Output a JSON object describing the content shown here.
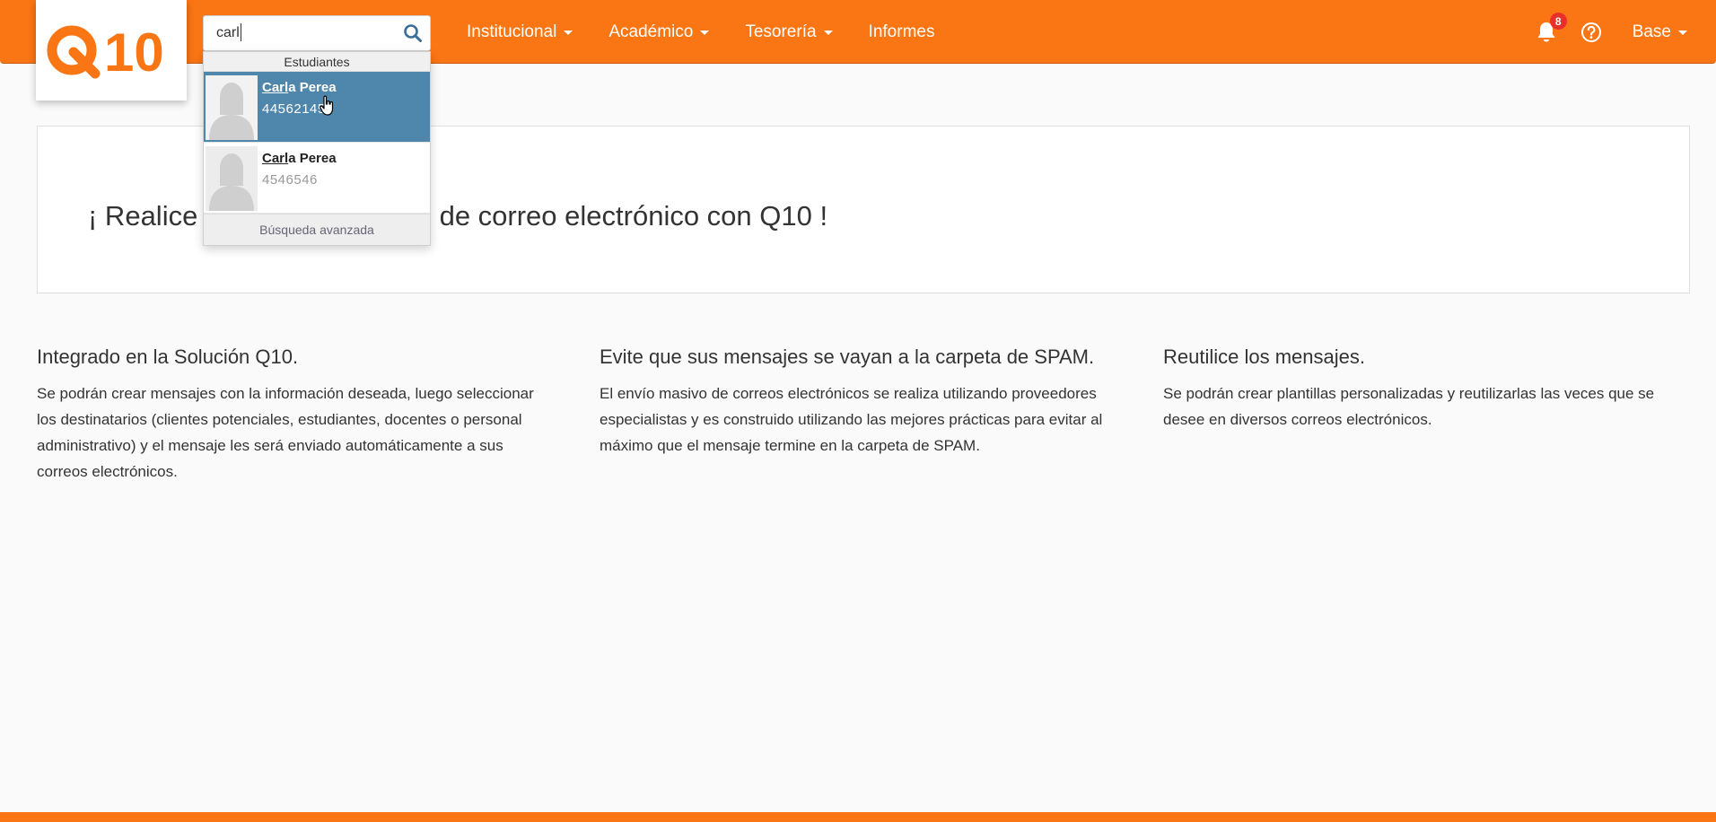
{
  "navbar": {
    "logo_text": "Q10",
    "search": {
      "value": "carl",
      "placeholder": ""
    },
    "menu": [
      {
        "label": "Institucional",
        "has_dropdown": true
      },
      {
        "label": "Académico",
        "has_dropdown": true
      },
      {
        "label": "Tesorería",
        "has_dropdown": true
      },
      {
        "label": "Informes",
        "has_dropdown": false
      }
    ],
    "notifications_count": "8",
    "user_label": "Base"
  },
  "autocomplete": {
    "section_header": "Estudiantes",
    "results": [
      {
        "name_match": "Carl",
        "name_rest": "a Perea",
        "id": "44562145",
        "selected": true
      },
      {
        "name_match": "Carl",
        "name_rest": "a Perea",
        "id": "4546546",
        "selected": false
      }
    ],
    "advanced_search_label": "Búsqueda avanzada"
  },
  "hero": {
    "title_start": "¡ Realice",
    "title_end": "de correo electrónico con Q10 !"
  },
  "features": [
    {
      "title": "Integrado en la Solución Q10.",
      "body": "Se podrán crear mensajes con la información deseada, luego seleccionar los destinatarios (clientes potenciales, estudiantes, docentes o personal administrativo) y el mensaje les será enviado automáticamente a sus correos electrónicos."
    },
    {
      "title": "Evite que sus mensajes se vayan a la carpeta de SPAM.",
      "body": "El envío masivo de correos electrónicos se realiza utilizando proveedores especialistas y es construido utilizando las mejores prácticas para evitar al máximo que el mensaje termine en la carpeta de SPAM."
    },
    {
      "title": "Reutilice los mensajes.",
      "body": "Se podrán crear plantillas personalizadas y reutilizarlas las veces que se desee en diversos correos electrónicos."
    }
  ],
  "colors": {
    "brand_orange": "#fa7514",
    "selected_row": "#4f86ab",
    "badge_red": "#e8302b"
  },
  "icons": [
    "search-icon",
    "bell-icon",
    "help-circle-icon",
    "chevron-down-icon",
    "avatar-placeholder-icon",
    "hand-pointer-icon"
  ]
}
